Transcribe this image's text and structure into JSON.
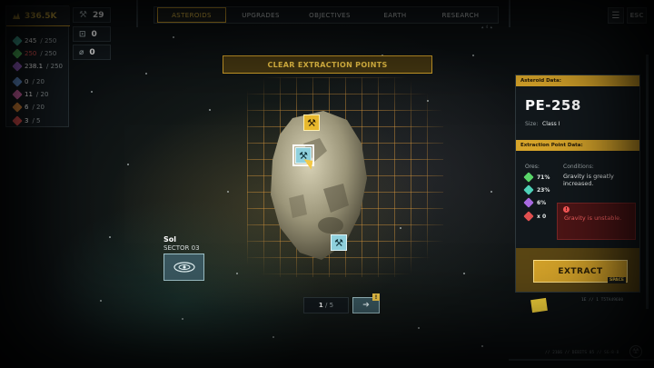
{
  "resources": {
    "credits": "336.5K",
    "items": [
      {
        "icon": "teal-ore-icon",
        "color": "#4fd1b8",
        "amount": "245",
        "max": "/ 250",
        "warn": false
      },
      {
        "icon": "green-ore-icon",
        "color": "#5ad66a",
        "amount": "250",
        "max": "/ 250",
        "warn": true
      },
      {
        "icon": "purple-ore-icon",
        "color": "#a86ae0",
        "amount": "238.1",
        "max": "/ 250",
        "warn": false
      },
      {
        "icon": "blue-crystal-icon",
        "color": "#6a9ce0",
        "amount": "0",
        "max": "/ 20",
        "warn": false
      },
      {
        "icon": "pink-crystal-icon",
        "color": "#e06ab4",
        "amount": "11",
        "max": "/ 20",
        "warn": false
      },
      {
        "icon": "orange-crystal-icon",
        "color": "#e08a3a",
        "amount": "6",
        "max": "/ 20",
        "warn": false
      },
      {
        "icon": "red-crystal-icon",
        "color": "#e05050",
        "amount": "3",
        "max": "/ 5",
        "warn": false
      }
    ]
  },
  "tools": {
    "drills": "29",
    "scanners": "0",
    "probes": "0"
  },
  "nav": {
    "tabs": [
      "ASTEROIDS",
      "UPGRADES",
      "OBJECTIVES",
      "EARTH",
      "RESEARCH"
    ],
    "active": "ASTEROIDS",
    "tick": "▲ 4 ▲"
  },
  "menu_icon": "menu-icon",
  "esc_label": "ESC",
  "banner": "CLEAR EXTRACTION POINTS",
  "sector": {
    "name": "Sol",
    "sector": "SECTOR 03"
  },
  "pager": {
    "current": "1",
    "total": "/ 5",
    "alert": "!"
  },
  "asteroid": {
    "header": "Asteroid Data:",
    "name": "PE-258",
    "size_label": "Size:",
    "size_value": "Class I",
    "ep_header": "Extraction Point Data:",
    "ores_label": "Ores:",
    "conditions_label": "Conditions:",
    "ores": [
      {
        "icon": "green-ore-icon",
        "color": "#5ad66a",
        "pct": "71%"
      },
      {
        "icon": "teal-ore-icon",
        "color": "#4fd1b8",
        "pct": "23%"
      },
      {
        "icon": "purple-ore-icon",
        "color": "#a86ae0",
        "pct": "6%"
      },
      {
        "icon": "red-crystal-icon",
        "color": "#e05050",
        "pct": "x 0"
      }
    ],
    "condition_good": "Gravity is greatly increased.",
    "condition_bad": "Gravity is unstable.",
    "warn_symbol": "!"
  },
  "extract": {
    "label": "EXTRACT",
    "key": "SPACE"
  },
  "build_id": "1E // 1 T5TA49600",
  "footer": "// 2166 // DEBITS 05 // SG-8-B",
  "accent": "#d6a42a"
}
